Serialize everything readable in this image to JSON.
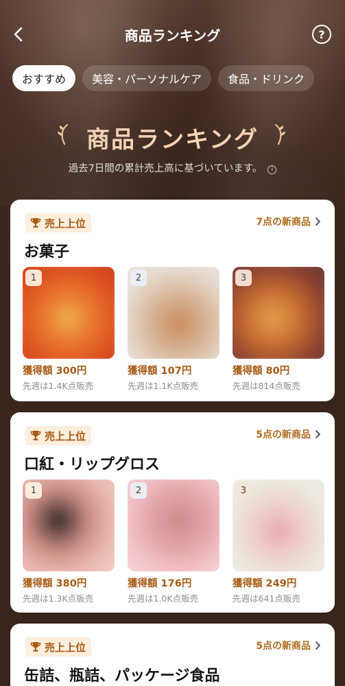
{
  "header": {
    "title": "商品ランキング",
    "back_icon": "chevron-left-icon",
    "help_symbol": "?"
  },
  "tabs": [
    {
      "label": "おすすめ",
      "active": true
    },
    {
      "label": "美容・パーソナルケア",
      "active": false
    },
    {
      "label": "食品・ドリンク",
      "active": false
    }
  ],
  "hero": {
    "title": "商品ランキング",
    "subtitle": "過去7日間の累計売上高に基づいています。",
    "info_symbol": "i"
  },
  "cards": [
    {
      "badge": "売上上位",
      "new_link": "7点の新商品",
      "title": "お菓子",
      "products": [
        {
          "rank": "1",
          "earned": "獲得額 300円",
          "sold": "先週は1.4K点販売"
        },
        {
          "rank": "2",
          "earned": "獲得額 107円",
          "sold": "先週は1.1K点販売"
        },
        {
          "rank": "3",
          "earned": "獲得額 80円",
          "sold": "先週は814点販売"
        }
      ]
    },
    {
      "badge": "売上上位",
      "new_link": "5点の新商品",
      "title": "口紅・リップグロス",
      "products": [
        {
          "rank": "1",
          "earned": "獲得額 380円",
          "sold": "先週は1.3K点販売"
        },
        {
          "rank": "2",
          "earned": "獲得額 176円",
          "sold": "先週は1.0K点販売"
        },
        {
          "rank": "3",
          "earned": "獲得額 249円",
          "sold": "先週は641点販売"
        }
      ]
    },
    {
      "badge": "売上上位",
      "new_link": "5点の新商品",
      "title": "缶詰、瓶詰、パッケージ食品"
    }
  ],
  "colors": {
    "accent": "#a65a14",
    "badge_bg": "#fdeedd",
    "hero_title": "#f3d3b5"
  }
}
